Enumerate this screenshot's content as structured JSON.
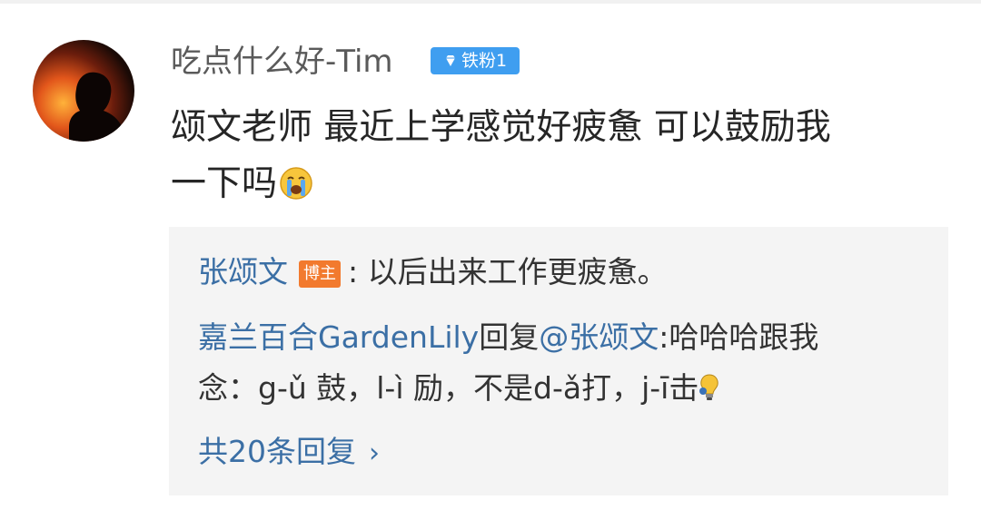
{
  "comment": {
    "username": "吃点什么好-Tim",
    "fan_badge": "铁粉1",
    "text_line1": "颂文老师 最近上学感觉好疲惫 可以鼓励我",
    "text_line2": "一下吗"
  },
  "replies": [
    {
      "author": "张颂文",
      "author_badge": "博主",
      "separator": ":",
      "text": " 以后出来工作更疲惫。"
    },
    {
      "author": "嘉兰百合GardenLily",
      "reply_word": "回复",
      "mention": "@张颂文",
      "text_part1": ":哈哈哈跟我",
      "text_part2": "念：g-ǔ 鼓，l-ì 励，不是d-ǎ打，j-ī击"
    }
  ],
  "more_replies": {
    "label": "共20条回复",
    "chevron": "›"
  },
  "colors": {
    "link": "#3b6fa5",
    "fan_badge": "#3f9ef0",
    "boss_badge": "#f27a2e",
    "reply_bg": "#f4f4f4"
  },
  "icons": [
    "avatar-sunset-silhouette",
    "diamond-icon",
    "crying-emoji-icon",
    "lightbulb-emoji-icon",
    "chevron-right-icon"
  ]
}
